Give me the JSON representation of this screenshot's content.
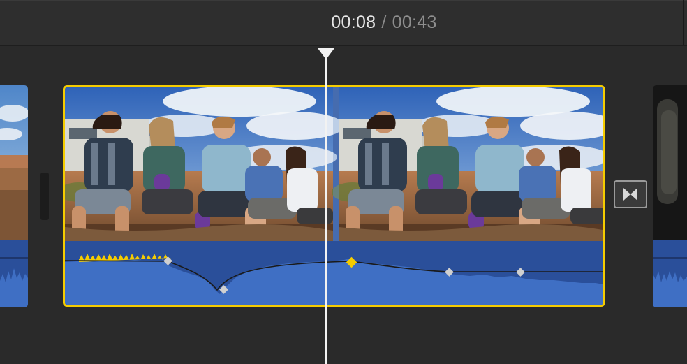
{
  "timecode": {
    "current": "00:08",
    "separator": "/",
    "total": "00:43"
  },
  "timeline": {
    "clips": [
      {
        "name": "previous-clip",
        "partial": true
      },
      {
        "name": "selected-clip",
        "selected": true
      },
      {
        "name": "next-clip",
        "partial": true
      }
    ],
    "transition_icon": "bowtie-transition-icon",
    "playhead_position": "00:08"
  },
  "colors": {
    "background": "#2a2a2a",
    "selection": "#f5cc00",
    "audio_waveform": "#3f6fc4",
    "audio_track": "#2a4f9a",
    "playhead": "#f2f2f2",
    "volume_keyframe": "#cfcfcf",
    "selected_keyframe": "#f5cc00"
  }
}
